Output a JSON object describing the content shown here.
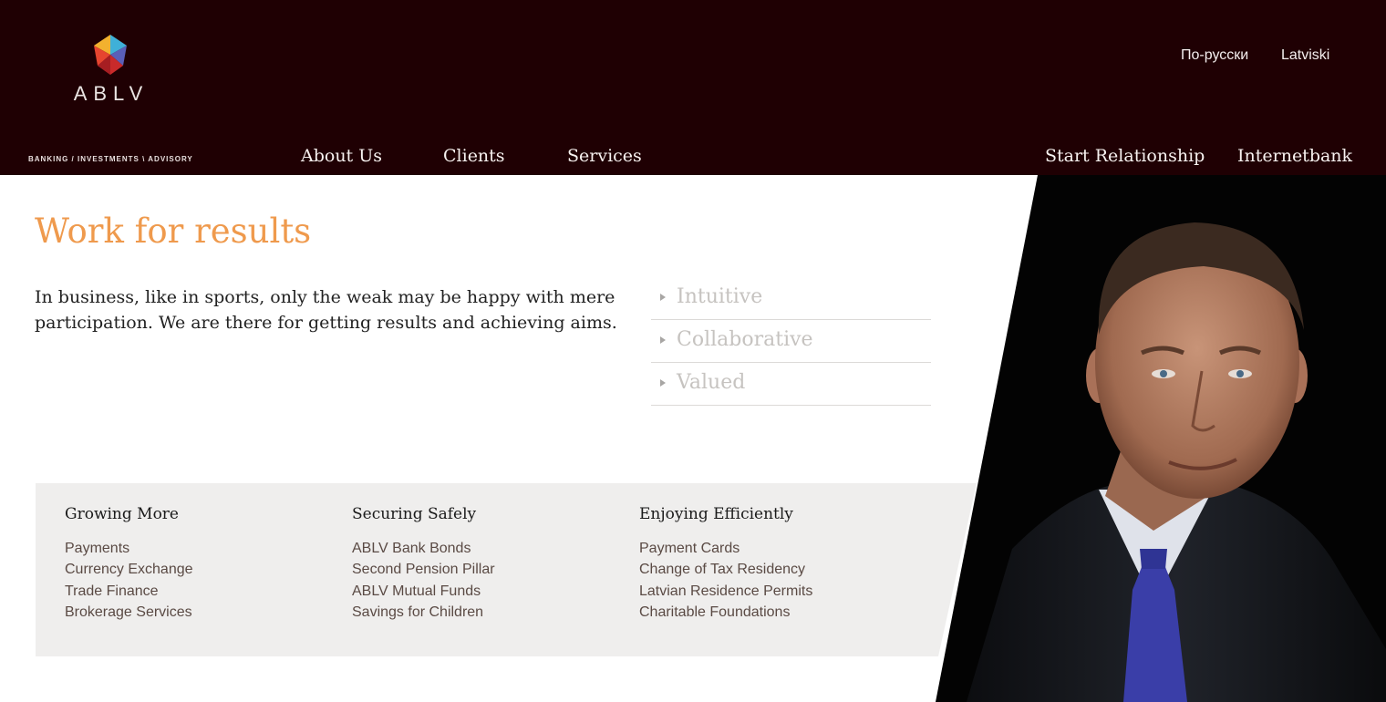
{
  "brand": {
    "name": "ABLV",
    "tagline": "BANKING / INVESTMENTS \\ ADVISORY"
  },
  "languages": [
    "По-русски",
    "Latviski"
  ],
  "nav": {
    "main": [
      "About Us",
      "Clients",
      "Services"
    ],
    "right": [
      "Start Relationship",
      "Internetbank"
    ]
  },
  "hero": {
    "title": "Work for results",
    "text": "In business, like in sports, only the weak may be happy with mere participation. We are there for getting results and achieving aims.",
    "values": [
      "Intuitive",
      "Collaborative",
      "Valued"
    ]
  },
  "services": [
    {
      "title": "Growing More",
      "items": [
        "Payments",
        "Currency Exchange",
        "Trade Finance",
        "Brokerage Services"
      ]
    },
    {
      "title": "Securing Safely",
      "items": [
        "ABLV Bank Bonds",
        "Second Pension Pillar",
        "ABLV Mutual Funds",
        "Savings for Children"
      ]
    },
    {
      "title": "Enjoying Efficiently",
      "items": [
        "Payment Cards",
        "Change of Tax Residency",
        "Latvian Residence Permits",
        "Charitable Foundations"
      ]
    }
  ],
  "colors": {
    "header_bg": "#1f0003",
    "accent": "#ef9a4d",
    "services_bg": "#efeeed"
  }
}
